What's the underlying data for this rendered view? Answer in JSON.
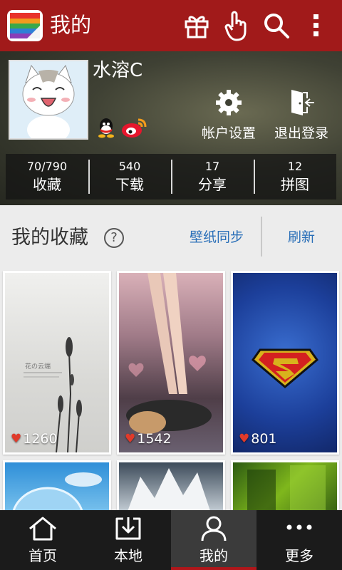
{
  "topbar": {
    "title": "我的",
    "icons": [
      "app-logo-icon",
      "gift-icon",
      "hand-pointer-icon",
      "search-icon",
      "more-vertical-icon"
    ],
    "bg_color": "#a11a1a"
  },
  "profile": {
    "username": "水溶C",
    "social_icons": [
      "qq-icon",
      "weibo-icon"
    ],
    "actions": {
      "account_settings": "帐户设置",
      "logout": "退出登录"
    },
    "stats": [
      {
        "value": "70/790",
        "label": "收藏"
      },
      {
        "value": "540",
        "label": "下载"
      },
      {
        "value": "17",
        "label": "分享"
      },
      {
        "value": "12",
        "label": "拼图"
      }
    ]
  },
  "section": {
    "title": "我的收藏",
    "help": "?",
    "sync_label": "壁纸同步",
    "refresh_label": "刷新",
    "link_color": "#2a6fb8"
  },
  "wallpapers": [
    {
      "likes": "1260"
    },
    {
      "likes": "1542"
    },
    {
      "likes": "801"
    }
  ],
  "bottom_nav": {
    "items": [
      {
        "label": "首页",
        "icon": "home-icon"
      },
      {
        "label": "本地",
        "icon": "download-icon"
      },
      {
        "label": "我的",
        "icon": "user-icon"
      },
      {
        "label": "更多",
        "icon": "more-horizontal-icon"
      }
    ],
    "active_index": 2,
    "active_color": "#b0161a"
  }
}
